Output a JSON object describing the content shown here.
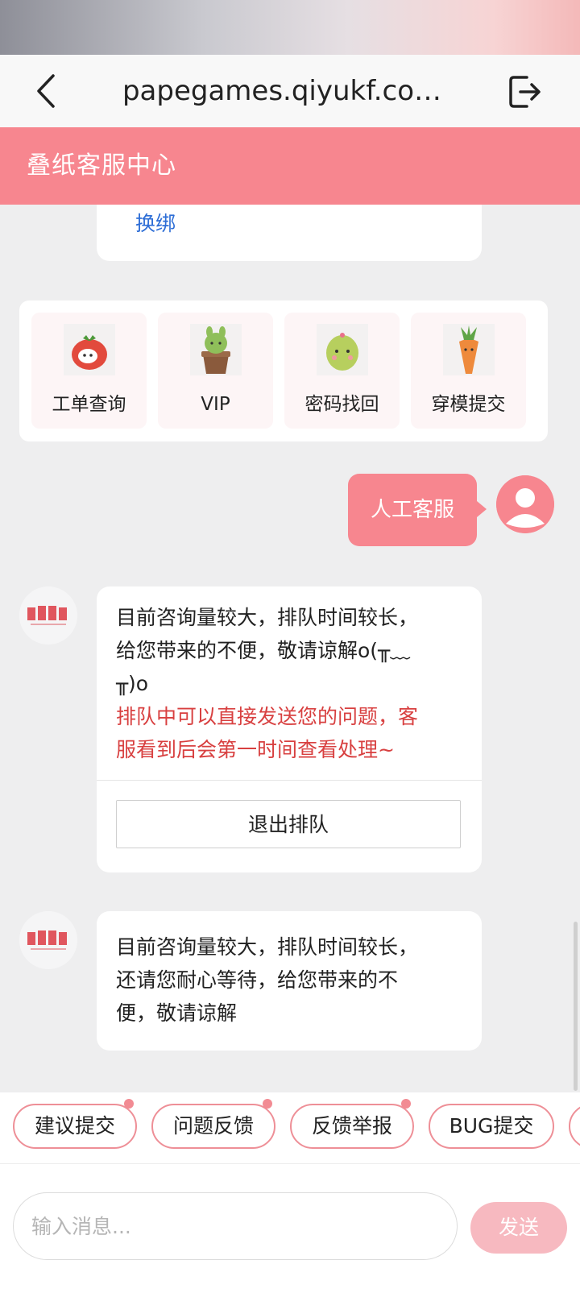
{
  "browser": {
    "url": "papegames.qiyukf.co…"
  },
  "header": {
    "title": "叠纸客服中心"
  },
  "account_card": {
    "link": "换绑"
  },
  "quick_actions": [
    {
      "label": "工单查询",
      "icon": "tomato-plush-icon"
    },
    {
      "label": "VIP",
      "icon": "cactus-pot-plush-icon"
    },
    {
      "label": "密码找回",
      "icon": "cactus-plush-icon"
    },
    {
      "label": "穿模提交",
      "icon": "carrot-plush-icon"
    }
  ],
  "user_message": {
    "text": "人工客服"
  },
  "bot_messages": [
    {
      "lines": [
        "目前咨询量较大，排队时间较长，",
        "给您带来的不便，敬请谅解o(╥﹏",
        "╥)o"
      ],
      "red_lines": [
        "排队中可以直接发送您的问题，客",
        "服看到后会第一时间查看处理~"
      ],
      "button": "退出排队"
    },
    {
      "lines": [
        "目前咨询量较大，排队时间较长，",
        "还请您耐心等待，给您带来的不",
        "便，敬请谅解"
      ]
    }
  ],
  "quick_chips": [
    {
      "label": "建议提交",
      "dot": true
    },
    {
      "label": "问题反馈",
      "dot": true
    },
    {
      "label": "反馈举报",
      "dot": true
    },
    {
      "label": "BUG提交",
      "dot": false
    }
  ],
  "composer": {
    "placeholder": "输入消息...",
    "send": "发送"
  },
  "colors": {
    "brand": "#f7868f",
    "link": "#2e6ed6",
    "alert": "#d84040"
  }
}
